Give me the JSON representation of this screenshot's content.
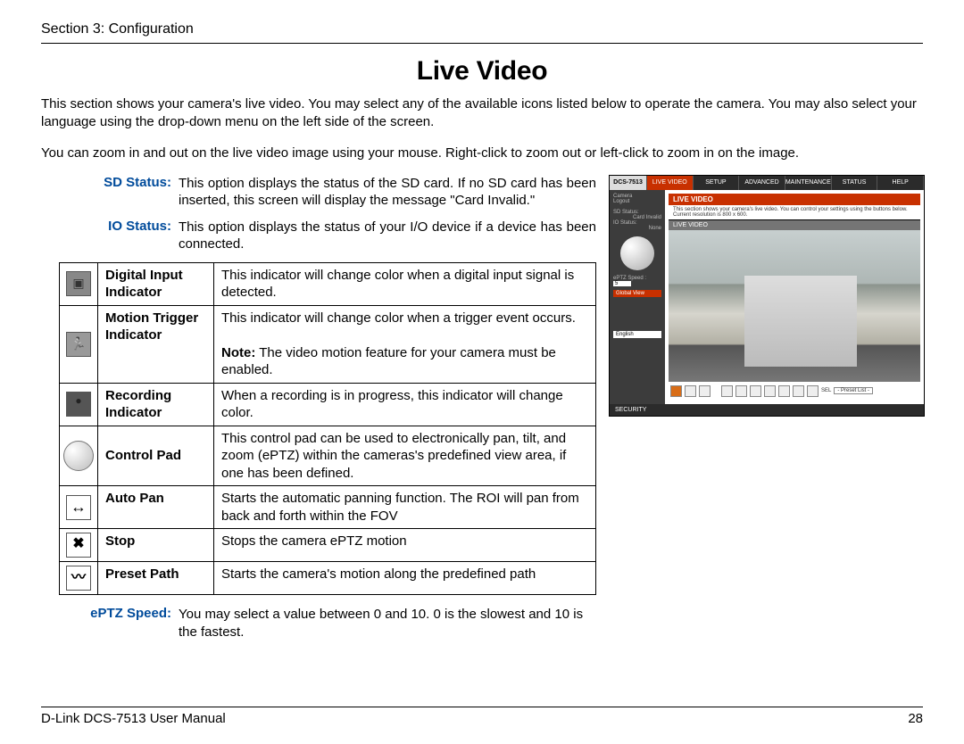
{
  "header": {
    "section": "Section 3: Configuration"
  },
  "title": "Live Video",
  "intro1": "This section shows your camera's live video. You may select any of the available icons listed below to operate the camera. You may also select your language using the drop-down menu on the left side of the screen.",
  "intro2": "You can zoom in and out on the live video image using your mouse. Right-click to zoom out or left-click to zoom in on the image.",
  "defs": [
    {
      "label": "SD Status:",
      "body": "This option displays the status of the SD card. If no SD card has been inserted, this screen will display the message \"Card Invalid.\""
    },
    {
      "label": "IO Status:",
      "body": "This option displays the status of your I/O device if a device has been connected."
    }
  ],
  "table": [
    {
      "icon": "input",
      "name": "Digital Input Indicator",
      "desc": "This indicator will change color when a digital input signal is detected."
    },
    {
      "icon": "motion",
      "name": "Motion Trigger Indicator",
      "desc": "This indicator will change color when a trigger event occurs.",
      "note_label": "Note:",
      "note": " The video motion feature for your camera must be enabled."
    },
    {
      "icon": "rec",
      "name": "Recording Indicator",
      "desc": "When a recording is in progress, this indicator will change color."
    },
    {
      "icon": "pad",
      "name": "Control Pad",
      "desc": "This control pad can be used to electronically pan, tilt, and zoom (ePTZ) within the cameras's predefined view area, if one has been defined."
    },
    {
      "icon": "arrows",
      "name": "Auto Pan",
      "desc": "Starts the automatic panning function. The ROI will pan from back and forth within the FOV"
    },
    {
      "icon": "x",
      "name": "Stop",
      "desc": "Stops the camera ePTZ motion"
    },
    {
      "icon": "path",
      "name": "Preset Path",
      "desc": "Starts the camera's motion along the predefined path"
    }
  ],
  "eptz": {
    "label": "ePTZ Speed:",
    "body": "You may select a value between 0 and 10. 0 is the slowest and 10 is the fastest."
  },
  "shot": {
    "model": "DCS-7513",
    "nav": [
      "LIVE VIDEO",
      "SETUP",
      "ADVANCED",
      "MAINTENANCE",
      "STATUS",
      "HELP"
    ],
    "pane_title": "LIVE VIDEO",
    "pane_sub": "This section shows your camera's live video. You can control your settings using the buttons below. Current resolution is 800 x 600.",
    "section": "LIVE VIDEO",
    "sidebar": {
      "camera": "Camera",
      "logout": "Logout",
      "sd": "SD Status:",
      "sd_val": "Card Invalid",
      "io": "IO Status:",
      "io_val": "None",
      "eptz": "ePTZ Speed :",
      "eptz_val": "5",
      "global": "Global View",
      "lang": "English"
    },
    "toolbar_preset": "- Preset List -",
    "toolbar_sel": "SEL",
    "foot": "SECURITY"
  },
  "footer": {
    "left": "D-Link DCS-7513 User Manual",
    "page": "28"
  }
}
